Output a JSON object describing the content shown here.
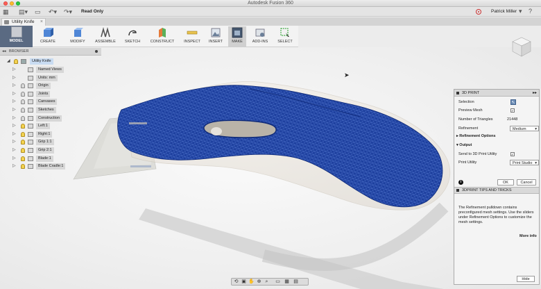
{
  "window": {
    "title": "Autodesk Fusion 360"
  },
  "qat": {
    "grid_icon": "grid-icon",
    "file_icon": "file-icon",
    "save_icon": "save-icon",
    "undo_icon": "undo-icon",
    "redo_icon": "redo-icon",
    "mode": "Read Only",
    "user_name": "Patrick Miller"
  },
  "document_tab": {
    "label": "Utility Knife"
  },
  "ribbon": {
    "workspace": "MODEL",
    "tools": [
      {
        "label": "CREATE",
        "icon": "create-icon"
      },
      {
        "label": "MODIFY",
        "icon": "modify-icon"
      },
      {
        "label": "ASSEMBLE",
        "icon": "assemble-icon"
      },
      {
        "label": "SKETCH",
        "icon": "sketch-icon"
      },
      {
        "label": "CONSTRUCT",
        "icon": "construct-icon"
      },
      {
        "label": "INSPECT",
        "icon": "inspect-icon"
      },
      {
        "label": "INSERT",
        "icon": "insert-icon"
      },
      {
        "label": "MAKE",
        "icon": "make-icon"
      },
      {
        "label": "ADD-INS",
        "icon": "addins-icon"
      },
      {
        "label": "SELECT",
        "icon": "select-icon"
      }
    ]
  },
  "browser": {
    "title": "BROWSER",
    "root": "Utility Knife",
    "items": [
      {
        "label": "Named Views",
        "bulb": "none"
      },
      {
        "label": "Units: mm",
        "bulb": "none"
      },
      {
        "label": "Origin",
        "bulb": "off"
      },
      {
        "label": "Joints",
        "bulb": "off"
      },
      {
        "label": "Canvases",
        "bulb": "off"
      },
      {
        "label": "Sketches",
        "bulb": "off"
      },
      {
        "label": "Construction",
        "bulb": "off"
      },
      {
        "label": "Left:1",
        "bulb": "on"
      },
      {
        "label": "Right:1",
        "bulb": "on"
      },
      {
        "label": "Grip 1:1",
        "bulb": "on"
      },
      {
        "label": "Grip 2:1",
        "bulb": "on"
      },
      {
        "label": "Blade:1",
        "bulb": "on"
      },
      {
        "label": "Blade Cradle:1",
        "bulb": "on"
      }
    ]
  },
  "print_panel": {
    "title": "3D PRINT",
    "selection_label": "Selection",
    "preview_mesh_label": "Preview Mesh",
    "triangles_label": "Number of Triangles",
    "triangles_value": "21448",
    "refinement_label": "Refinement",
    "refinement_value": "Medium",
    "refinement_options": "Refinement Options",
    "output_label": "Output",
    "send_label": "Send to 3D Print Utility",
    "utility_label": "Print Utility",
    "utility_value": "Print Studio",
    "ok": "OK",
    "cancel": "Cancel",
    "tips_title": "3DPRINT TIPS AND TRICKS",
    "tips_text": "The Refinement pulldown contains preconfigured mesh settings. Use the sliders under Refinement Options to customize the mesh settings.",
    "more_info": "More info",
    "hide": "Hide"
  },
  "colors": {
    "mesh_blue": "#1d3f9e",
    "ribbon_model": "#5a6a82"
  }
}
